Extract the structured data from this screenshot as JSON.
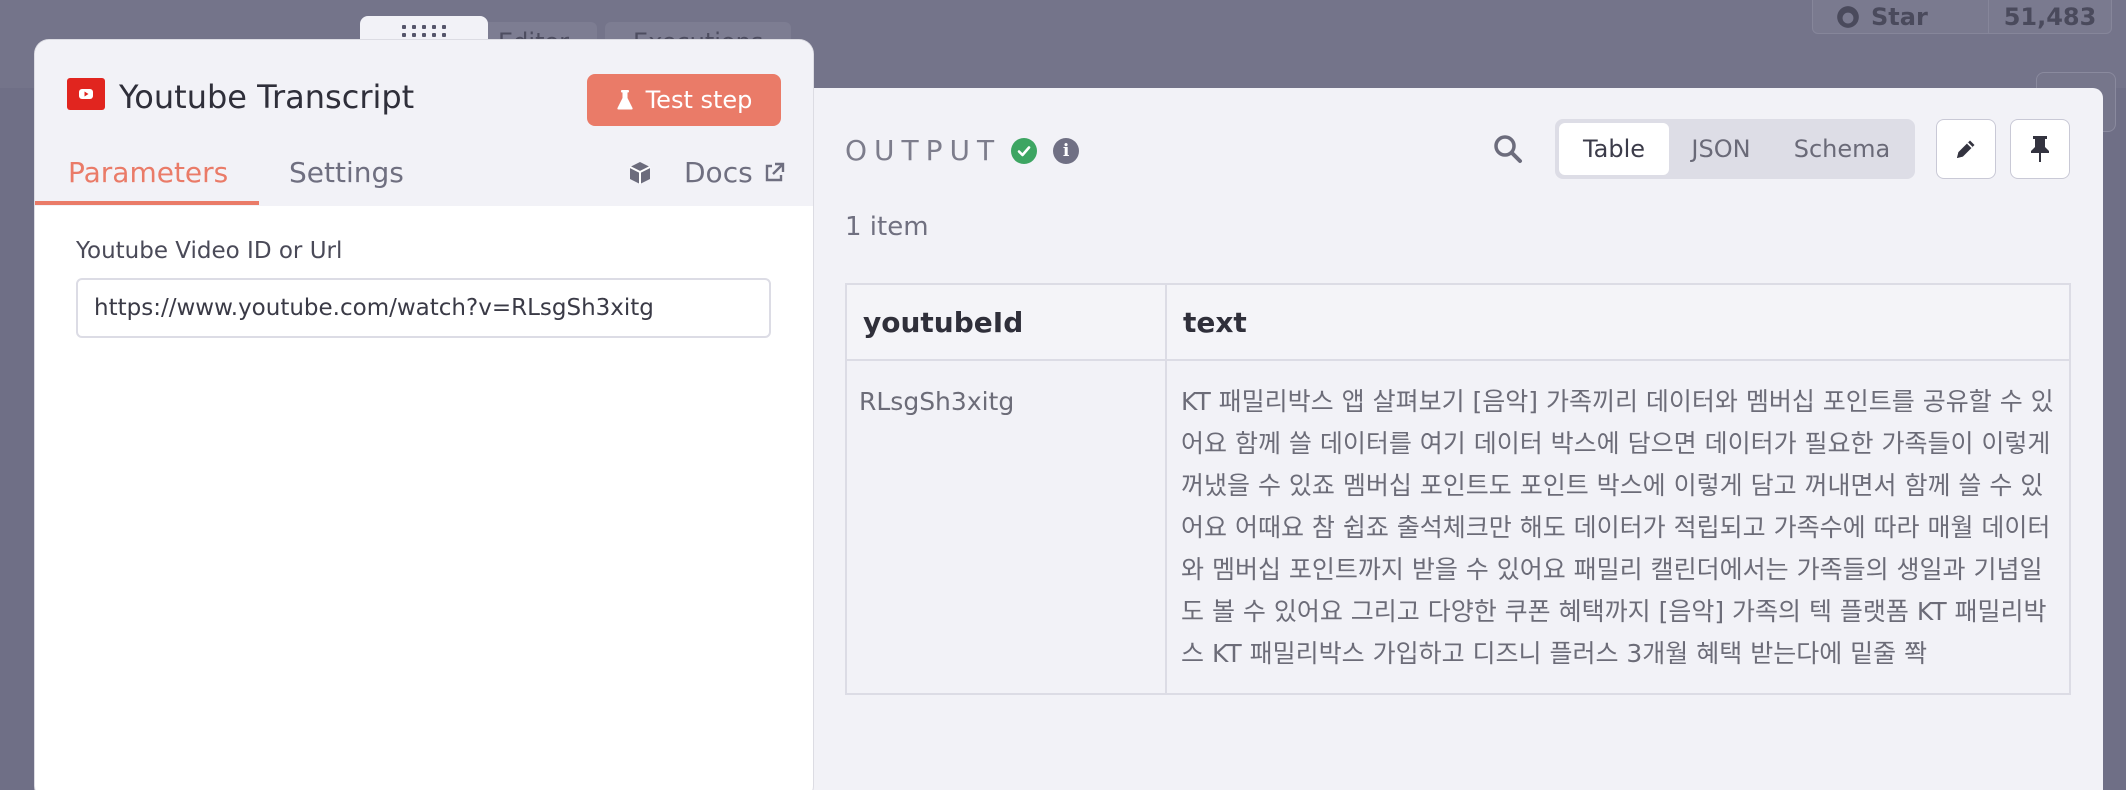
{
  "background": {
    "tabs": [
      "Editor",
      "Executions"
    ],
    "github": {
      "star_label": "Star",
      "star_count": "51,483"
    }
  },
  "node": {
    "title": "Youtube Transcript",
    "icon": "youtube-icon",
    "test_button": "Test step",
    "tabs": {
      "parameters": "Parameters",
      "settings": "Settings",
      "docs": "Docs"
    },
    "field": {
      "label": "Youtube Video ID or Url",
      "value": "https://www.youtube.com/watch?v=RLsgSh3xitg"
    }
  },
  "output": {
    "title": "OUTPUT",
    "status": "success",
    "views": [
      "Table",
      "JSON",
      "Schema"
    ],
    "active_view": "Table",
    "item_count": "1 item",
    "table": {
      "headers": [
        "youtubeId",
        "text"
      ],
      "rows": [
        {
          "youtubeId": "RLsgSh3xitg",
          "text": "KT 패밀리박스 앱 살펴보기 [음악] 가족끼리 데이터와 멤버십 포인트를 공유할 수 있어요 함께 쓸 데이터를 여기 데이터 박스에 담으면 데이터가 필요한 가족들이 이렇게 꺼냈을 수 있죠 멤버십 포인트도 포인트 박스에 이렇게 담고 꺼내면서 함께 쓸 수 있어요 어때요 참 쉽죠 출석체크만 해도 데이터가 적립되고 가족수에 따라 매월 데이터와 멤버십 포인트까지 받을 수 있어요 패밀리 캘린더에서는 가족들의 생일과 기념일도 볼 수 있어요 그리고 다양한 쿠폰 혜택까지 [음악] 가족의 텍 플랫폼 KT 패밀리박스 KT 패밀리박스 가입하고 디즈니 플러스 3개월 혜택 받는다에 밑줄 쫙"
        }
      ]
    }
  },
  "colors": {
    "accent": "#ea7b68",
    "success": "#3da562",
    "youtube": "#e1251f"
  }
}
